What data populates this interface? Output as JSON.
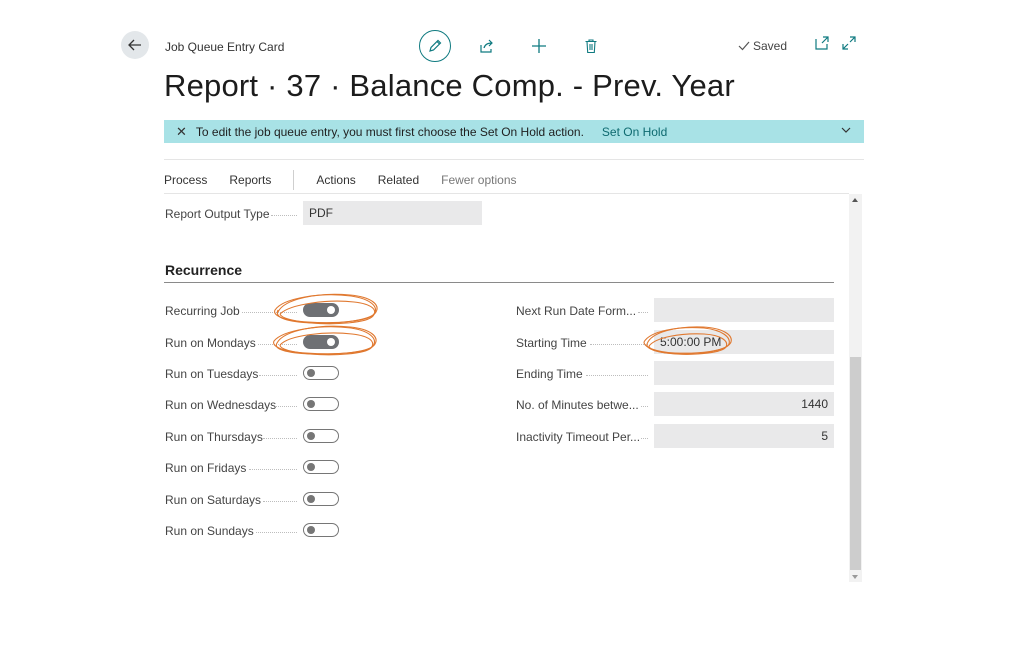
{
  "header": {
    "breadcrumb": "Job Queue Entry Card",
    "saved": "Saved",
    "title": "Report · 37 · Balance Comp. - Prev. Year"
  },
  "banner": {
    "message": "To edit the job queue entry, you must first choose the Set On Hold action.",
    "action": "Set On Hold"
  },
  "menu": {
    "items": [
      "Process",
      "Reports",
      "Actions",
      "Related",
      "Fewer options"
    ]
  },
  "fields": {
    "report_output_type": {
      "label": "Report Output Type",
      "value": "PDF"
    }
  },
  "recurrence": {
    "title": "Recurrence",
    "toggles": [
      {
        "label": "Recurring Job",
        "on": true
      },
      {
        "label": "Run on Mondays",
        "on": true
      },
      {
        "label": "Run on Tuesdays",
        "on": false
      },
      {
        "label": "Run on Wednesdays",
        "on": false
      },
      {
        "label": "Run on Thursdays",
        "on": false
      },
      {
        "label": "Run on Fridays",
        "on": false
      },
      {
        "label": "Run on Saturdays",
        "on": false
      },
      {
        "label": "Run on Sundays",
        "on": false
      }
    ],
    "right_fields": [
      {
        "label": "Next Run Date Form...",
        "value": ""
      },
      {
        "label": "Starting Time",
        "value": "5:00:00 PM"
      },
      {
        "label": "Ending Time",
        "value": ""
      },
      {
        "label": "No. of Minutes betwe...",
        "value": "1440"
      },
      {
        "label": "Inactivity Timeout Per...",
        "value": "5"
      }
    ]
  },
  "colors": {
    "banner": "#a8e2e6",
    "accent": "#0f7a80",
    "annotation": "#e0782f"
  },
  "icons": [
    "back-arrow-icon",
    "edit-pencil-icon",
    "share-icon",
    "plus-icon",
    "trash-icon",
    "checkmark-icon",
    "open-new-window-icon",
    "expand-icon",
    "close-icon",
    "chevron-down-icon"
  ]
}
